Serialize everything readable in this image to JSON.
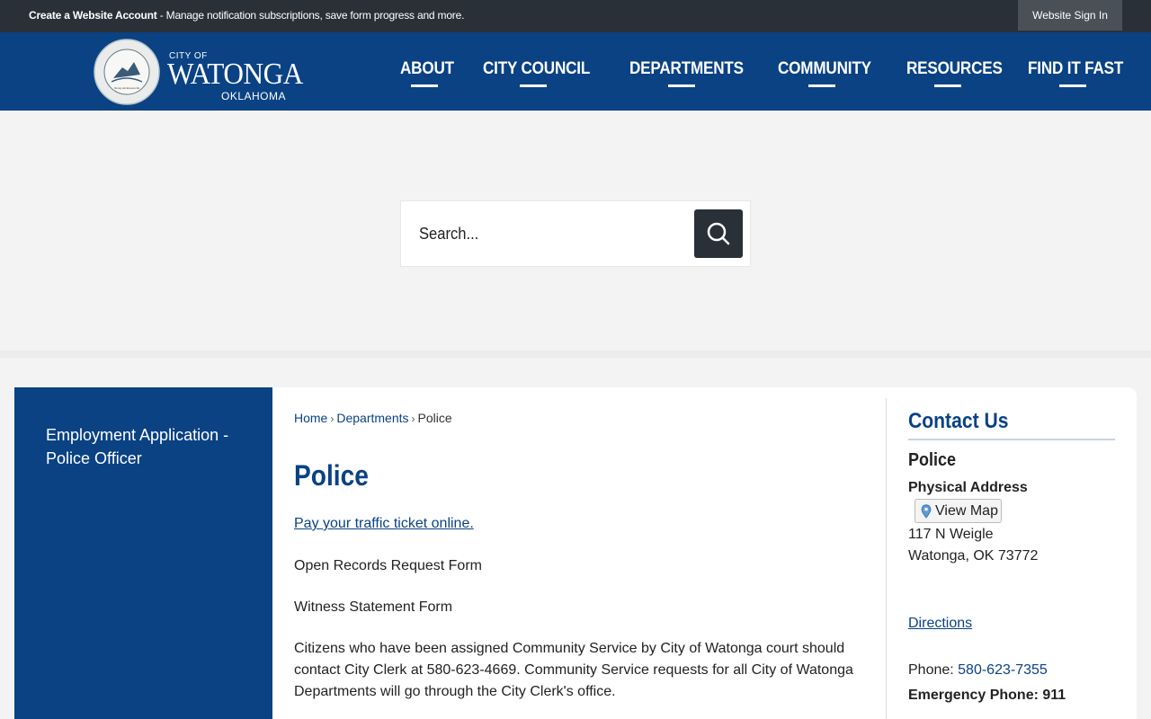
{
  "topbar": {
    "account_link": "Create a Website Account",
    "account_text": " - Manage notification subscriptions, save form progress and more.",
    "signin": "Website Sign In"
  },
  "logo": {
    "city_of": "CITY OF",
    "name": "WATONGA",
    "state": "OKLAHOMA",
    "seal_top": "THE CITY of WATONGA",
    "seal_bottom": "OKLAHOMA"
  },
  "nav": {
    "items": [
      "ABOUT",
      "CITY COUNCIL",
      "DEPARTMENTS",
      "COMMUNITY",
      "RESOURCES",
      "FIND IT FAST"
    ]
  },
  "search": {
    "placeholder": "Search..."
  },
  "sidebar": {
    "link": "Employment Application - Police Officer"
  },
  "breadcrumb": {
    "home": "Home",
    "sep": "›",
    "departments": "Departments",
    "current": "Police"
  },
  "main": {
    "title": "Police",
    "traffic_link": "Pay your traffic ticket online.",
    "records": "Open Records Request Form",
    "witness": "Witness Statement Form",
    "community_service": "Citizens who have been assigned Community Service by City of Watonga court should contact City Clerk at 580-623-4669.  Community Service requests for all City of Watonga Departments will go through the City Clerk's office."
  },
  "contact": {
    "title": "Contact Us",
    "dept": "Police",
    "address_label": "Physical Address",
    "view_map": "View Map",
    "address_line1": "117 N Weigle",
    "address_line2": "Watonga, OK 73772",
    "directions": "Directions",
    "phone_label": "Phone: ",
    "phone": "580-623-7355",
    "emergency": "Emergency Phone: 911"
  },
  "colors": {
    "brand_blue": "#0a4283",
    "topbar_dark": "#2a3038"
  }
}
